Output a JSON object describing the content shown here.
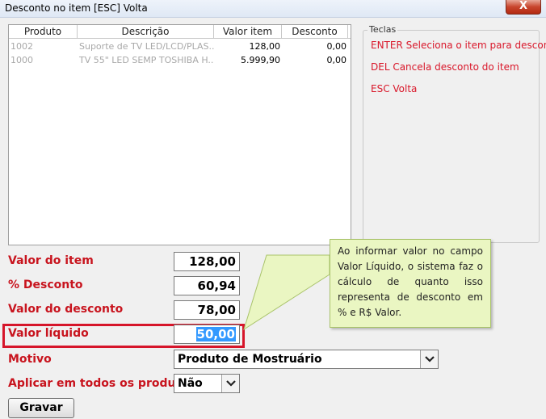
{
  "window": {
    "title": "Desconto no item [ESC] Volta",
    "close_label": "X"
  },
  "grid": {
    "columns": [
      "Produto",
      "Descrição",
      "Valor item",
      "Desconto"
    ],
    "rows": [
      {
        "produto": "1002",
        "descricao": "Suporte de TV LED/LCD/PLAS...",
        "valor_item": "128,00",
        "desconto": "0,00"
      },
      {
        "produto": "1000",
        "descricao": "TV 55\" LED SEMP TOSHIBA H...",
        "valor_item": "5.999,90",
        "desconto": "0,00"
      }
    ]
  },
  "teclas": {
    "legend": "Teclas",
    "lines": [
      "ENTER Seleciona o item para desconto",
      "DEL Cancela desconto do item",
      "ESC Volta"
    ]
  },
  "form": {
    "valor_item_label": "Valor do item",
    "valor_item_value": "128,00",
    "perc_desconto_label": "% Desconto",
    "perc_desconto_value": "60,94",
    "valor_desconto_label": "Valor do desconto",
    "valor_desconto_value": "78,00",
    "valor_liquido_label": "Valor líquido",
    "valor_liquido_value": "50,00",
    "motivo_label": "Motivo",
    "motivo_value": "Produto de Mostruário",
    "aplicar_label": "Aplicar em todos os produtos",
    "aplicar_value": "Não",
    "gravar_label": "Gravar"
  },
  "callout": {
    "text": "Ao informar valor no campo Valor Líquido, o sistema faz o cálculo de quanto isso representa de desconto em % e R$ Valor."
  },
  "colors": {
    "label_red": "#c8141e",
    "highlight_red": "#d6152a",
    "callout_bg": "#eaf6c2",
    "selection_blue": "#3399ff"
  }
}
